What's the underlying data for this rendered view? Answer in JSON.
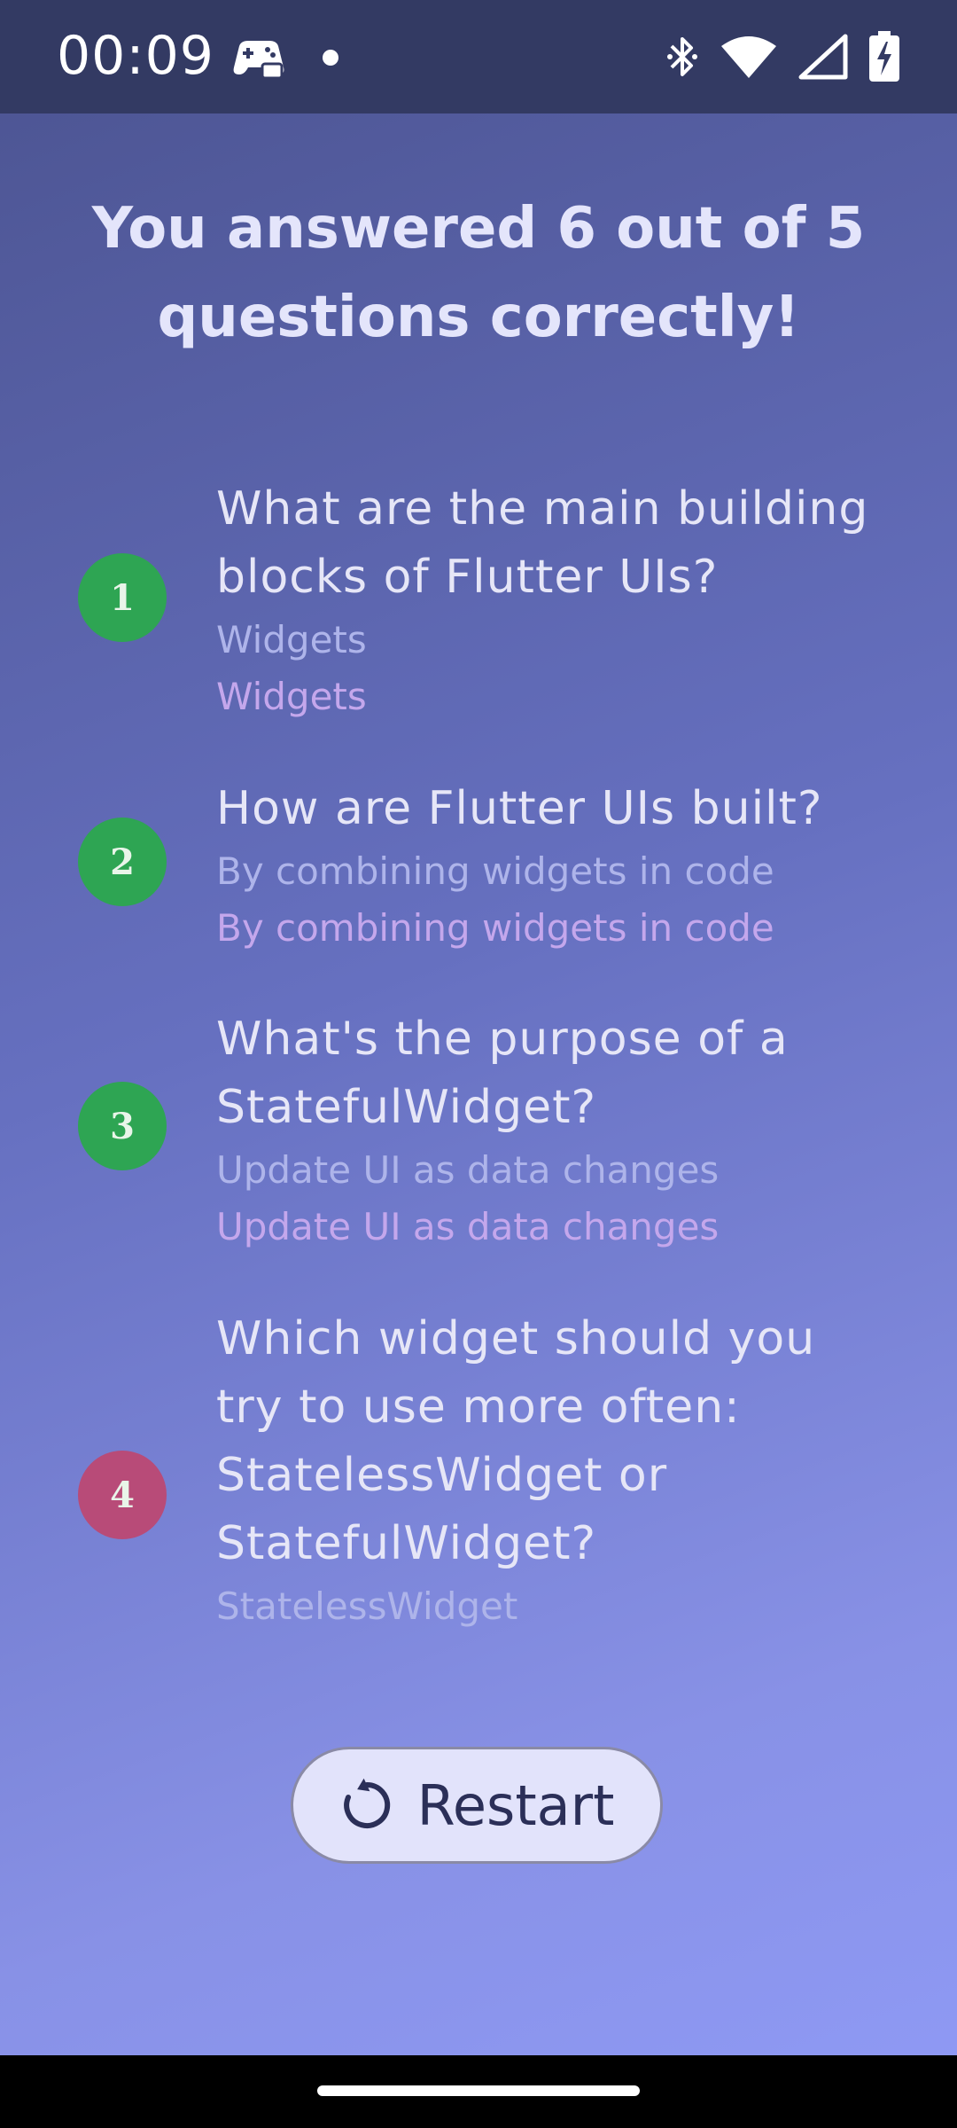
{
  "status_bar": {
    "time": "00:09",
    "icons": [
      "game-controller-icon",
      "notification-dot-icon",
      "bluetooth-icon",
      "wifi-icon",
      "signal-icon",
      "battery-charging-icon"
    ]
  },
  "result": {
    "title": "You answered 6 out of 5 questions correctly!"
  },
  "summary": [
    {
      "index": "1",
      "question": "What are the main building blocks of Flutter UIs?",
      "user_answer": "Widgets",
      "correct_answer": "Widgets",
      "is_correct": true
    },
    {
      "index": "2",
      "question": "How are Flutter UIs built?",
      "user_answer": "By combining widgets in code",
      "correct_answer": "By combining widgets in code",
      "is_correct": true
    },
    {
      "index": "3",
      "question": "What's the purpose of a StatefulWidget?",
      "user_answer": "Update UI as data changes",
      "correct_answer": "Update UI as data changes",
      "is_correct": true
    },
    {
      "index": "4",
      "question": "Which widget should you try to use more often: StatelessWidget or StatefulWidget?",
      "user_answer": "StatelessWidget",
      "correct_answer": "",
      "is_correct": false
    }
  ],
  "restart_button": {
    "label": "Restart",
    "icon": "restart-icon"
  },
  "colors": {
    "correct_badge": "#2ea553",
    "wrong_badge": "#b84b78",
    "status_bar_bg": "#333a63",
    "title_text": "#e4e5fb",
    "user_answer_text": "#aeb4ea",
    "correct_answer_text": "#c4a7ec",
    "button_bg": "#e2e3fb"
  }
}
